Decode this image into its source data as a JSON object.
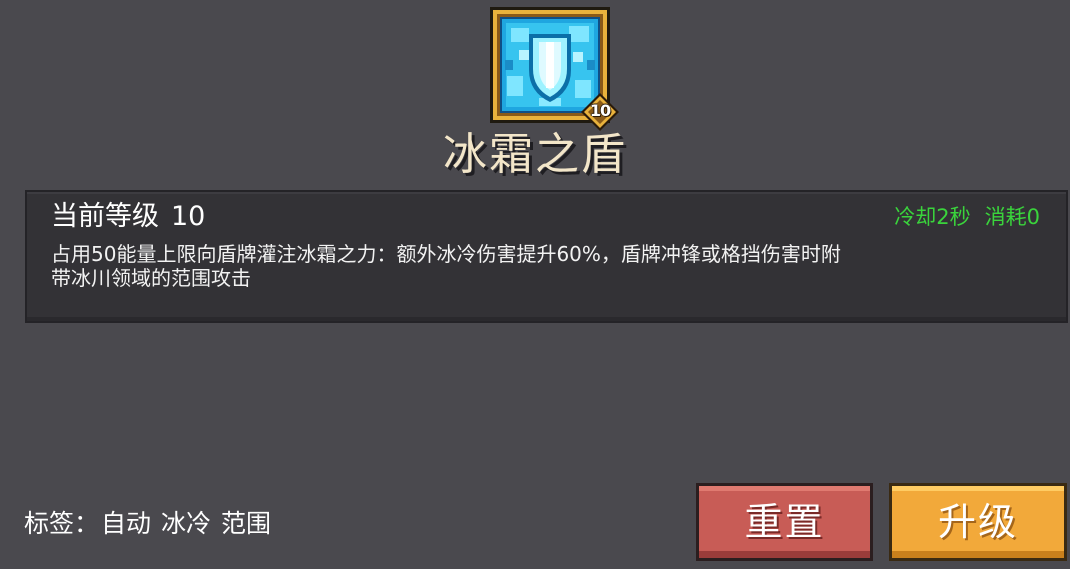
{
  "skill": {
    "name": "冰霜之盾",
    "level_badge": "10",
    "icon": "frost-shield-icon"
  },
  "panel": {
    "level_label": "当前等级",
    "level_value": "10",
    "cooldown": "冷却2秒",
    "cost": "消耗0",
    "description_line1": "占用50能量上限向盾牌灌注冰霜之力：额外冰冷伤害提升60%，盾牌冲锋或格挡伤害时附",
    "description_line2": "带冰川领域的范围攻击"
  },
  "tags": {
    "label": "标签：",
    "items": [
      "自动",
      "冰冷",
      "范围"
    ]
  },
  "buttons": {
    "reset": "重置",
    "upgrade": "升级"
  },
  "colors": {
    "background": "#4a494e",
    "panel": "#333236",
    "cooldown_text": "#3ad43c",
    "reset_button": "#c85c56",
    "upgrade_button": "#f2a93a",
    "icon_frame": "#e9b23c",
    "icon_glow": "#4fd8f0"
  }
}
